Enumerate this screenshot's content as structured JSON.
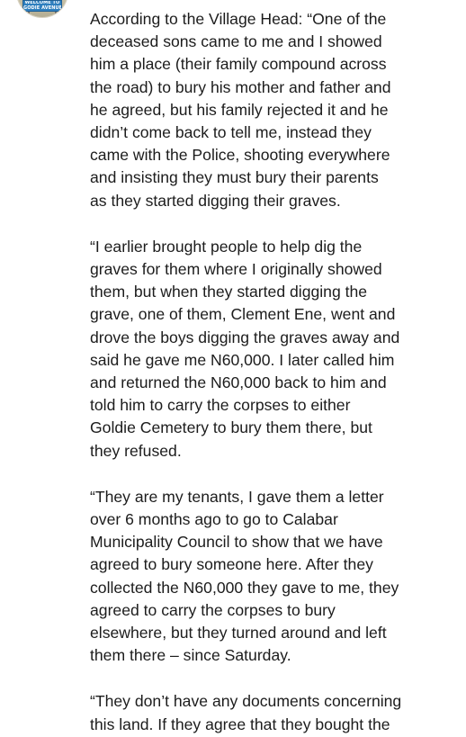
{
  "avatar": {
    "sign_line1": "WELCOME TO",
    "sign_line2": "GODIE AVENUE"
  },
  "paragraphs": [
    {
      "lines": [
        "According to the Village Head: “One of the",
        "deceased sons came to me and I showed",
        "him a place (their family compound across",
        "the road) to bury his mother and father and",
        "he agreed, but his family rejected it and he",
        "didn’t come back to tell me, instead they",
        "came with the Police, shooting everywhere",
        "and insisting they must bury their parents",
        "as they started digging their graves."
      ]
    },
    {
      "lines": [
        "“I earlier brought people to help dig the",
        "graves for them where I originally showed",
        "them, but when they started digging the",
        "grave, one of them, Clement Ene, went and",
        "drove the boys digging the graves away and",
        "said he gave me N60,000. I later called him",
        "and returned the N60,000 back to him and",
        "told him to carry the corpses to either",
        "Goldie Cemetery to bury them there, but",
        "they refused."
      ]
    },
    {
      "lines": [
        "“They are my tenants, I gave them a letter",
        "over 6 months ago to go to Calabar",
        "Municipality Council to show that we have",
        "agreed to bury someone here. After they",
        "collected the N60,000 they gave to me, they",
        "agreed to carry the corpses to bury",
        "elsewhere, but they turned around and left",
        "them there – since Saturday."
      ]
    },
    {
      "lines": [
        "“They don’t have any documents concerning",
        "this land. If they agree that they bought the"
      ]
    }
  ]
}
